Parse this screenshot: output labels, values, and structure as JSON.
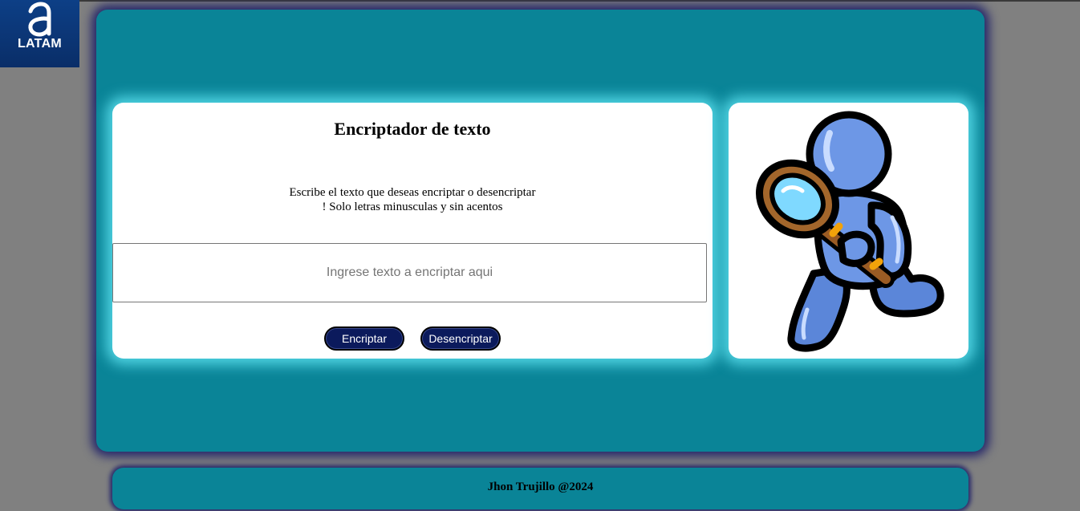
{
  "logo": {
    "text": "LATAM"
  },
  "encryptor": {
    "title": "Encriptador de texto",
    "instruction_line1": "Escribe el texto que deseas encriptar o desencriptar",
    "instruction_line2": "! Solo letras minusculas y sin acentos",
    "input_value": "",
    "input_placeholder": "Ingrese texto a encriptar aqui",
    "encrypt_label": "Encriptar",
    "decrypt_label": "Desencriptar"
  },
  "illustration": {
    "icon": "magnifier-figure-icon"
  },
  "footer": {
    "text": "Jhon Trujillo @2024"
  },
  "colors": {
    "page_background": "#808080",
    "panel": "#0a8497",
    "panel_shadow": "#24266a",
    "card_glow": "#4fd3e2",
    "button": "#0b1a5c",
    "logo_background": "#0d3f86"
  }
}
